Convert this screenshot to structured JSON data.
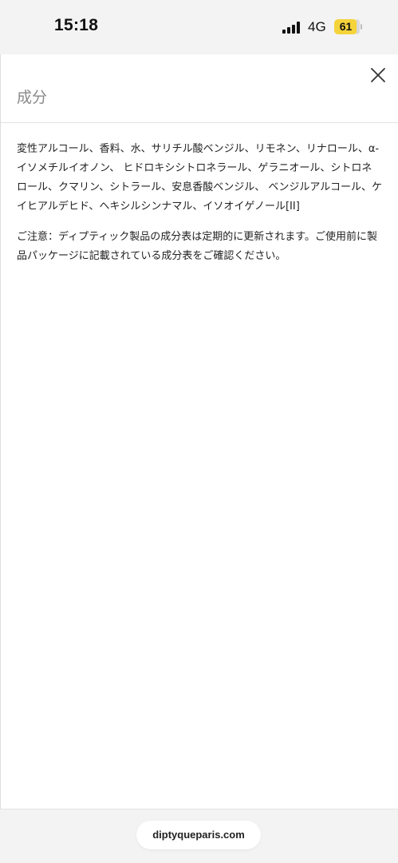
{
  "status_bar": {
    "time": "15:18",
    "network": "4G",
    "battery_level": "61",
    "battery_color": "#f5d33a"
  },
  "sheet": {
    "title": "成分",
    "close_icon": "close-icon",
    "ingredients": "変性アルコール、香料、水、サリチル酸ベンジル、リモネン、リナロール、α-イソメチルイオノン、 ヒドロキシシトロネラール、ゲラニオール、シトロネロール、クマリン、シトラール、安息香酸ベンジル、 ベンジルアルコール、ケイヒアルデヒド、ヘキシルシンナマル、イソオイゲノール[II]",
    "notice": "ご注意：ディプティック製品の成分表は定期的に更新されます。ご使用前に製品パッケージに記載されている成分表をご確認ください。"
  },
  "browser": {
    "url": "diptyqueparis.com"
  }
}
